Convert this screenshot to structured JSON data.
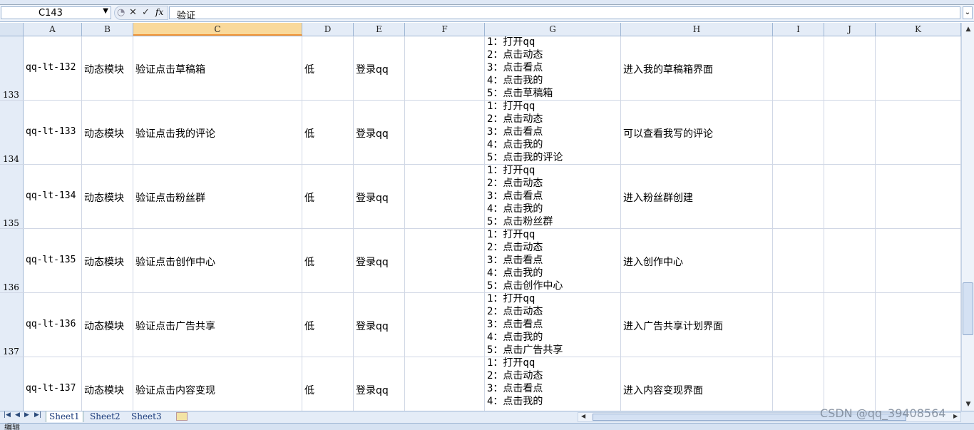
{
  "name_box": "C143",
  "formula_bar": {
    "cancel_icon": "✕",
    "enter_icon": "✓",
    "fx_label": "fx",
    "content": "验证"
  },
  "columns": [
    "A",
    "B",
    "C",
    "D",
    "E",
    "F",
    "G",
    "H",
    "I",
    "J",
    "K"
  ],
  "selected_column": "C",
  "rows": [
    {
      "num": "133",
      "a": "qq-lt-132",
      "b": "动态模块",
      "c": "验证点击草稿箱",
      "d": "低",
      "e": "登录qq",
      "f": "",
      "steps": [
        "1：打开qq",
        "2：点击动态",
        "3：点击看点",
        "4：点击我的",
        "5：点击草稿箱"
      ],
      "h": "进入我的草稿箱界面"
    },
    {
      "num": "134",
      "a": "qq-lt-133",
      "b": "动态模块",
      "c": "验证点击我的评论",
      "d": "低",
      "e": "登录qq",
      "f": "",
      "steps": [
        "1：打开qq",
        "2：点击动态",
        "3：点击看点",
        "4：点击我的",
        "5：点击我的评论"
      ],
      "h": "可以查看我写的评论"
    },
    {
      "num": "135",
      "a": "qq-lt-134",
      "b": "动态模块",
      "c": "验证点击粉丝群",
      "d": "低",
      "e": "登录qq",
      "f": "",
      "steps": [
        "1：打开qq",
        "2：点击动态",
        "3：点击看点",
        "4：点击我的",
        "5：点击粉丝群"
      ],
      "h": "进入粉丝群创建"
    },
    {
      "num": "136",
      "a": "qq-lt-135",
      "b": "动态模块",
      "c": "验证点击创作中心",
      "d": "低",
      "e": "登录qq",
      "f": "",
      "steps": [
        "1：打开qq",
        "2：点击动态",
        "3：点击看点",
        "4：点击我的",
        "5：点击创作中心"
      ],
      "h": "进入创作中心"
    },
    {
      "num": "137",
      "a": "qq-lt-136",
      "b": "动态模块",
      "c": "验证点击广告共享",
      "d": "低",
      "e": "登录qq",
      "f": "",
      "steps": [
        "1：打开qq",
        "2：点击动态",
        "3：点击看点",
        "4：点击我的",
        "5：点击广告共享"
      ],
      "h": "进入广告共享计划界面"
    },
    {
      "num": "",
      "a": "qq-lt-137",
      "b": "动态模块",
      "c": "验证点击内容变现",
      "d": "低",
      "e": "登录qq",
      "f": "",
      "steps": [
        "1：打开qq",
        "2：点击动态",
        "3：点击看点",
        "4：点击我的"
      ],
      "h": "进入内容变现界面"
    }
  ],
  "sheet_tabs": [
    "Sheet1",
    "Sheet2",
    "Sheet3"
  ],
  "active_sheet": "Sheet1",
  "status": {
    "mode": "编辑"
  },
  "watermark": "CSDN @qq_39408564",
  "colors": {
    "header_bg": "#e4ecf7",
    "selected_header": "#f9d99b",
    "gridline": "#d0d7e5"
  }
}
